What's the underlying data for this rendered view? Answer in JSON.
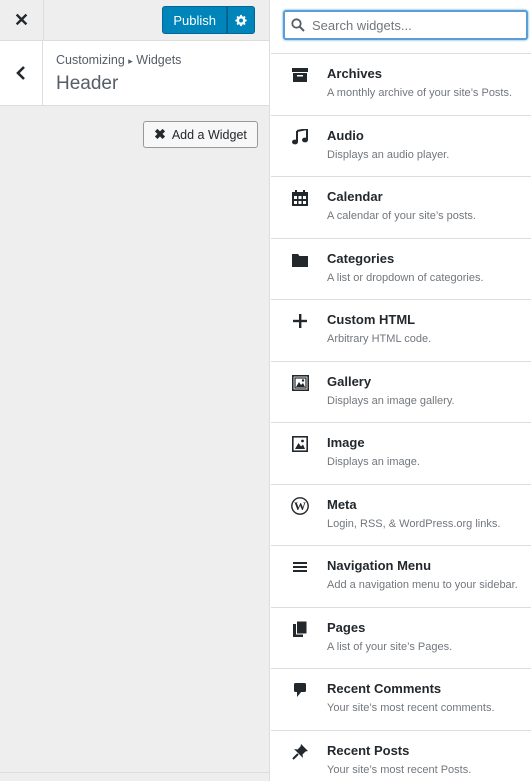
{
  "toolbar": {
    "publish_label": "Publish"
  },
  "section": {
    "breadcrumb_prefix": "Customizing",
    "breadcrumb_sep": "▸",
    "breadcrumb_panel": "Widgets",
    "title": "Header"
  },
  "add_widget_label": "Add a Widget",
  "search": {
    "placeholder": "Search widgets..."
  },
  "widgets": [
    {
      "name": "Archives",
      "desc": "A monthly archive of your site’s Posts.",
      "icon": "archive-icon"
    },
    {
      "name": "Audio",
      "desc": "Displays an audio player.",
      "icon": "music-icon"
    },
    {
      "name": "Calendar",
      "desc": "A calendar of your site’s posts.",
      "icon": "calendar-icon"
    },
    {
      "name": "Categories",
      "desc": "A list or dropdown of categories.",
      "icon": "folder-icon"
    },
    {
      "name": "Custom HTML",
      "desc": "Arbitrary HTML code.",
      "icon": "plus-icon"
    },
    {
      "name": "Gallery",
      "desc": "Displays an image gallery.",
      "icon": "gallery-icon"
    },
    {
      "name": "Image",
      "desc": "Displays an image.",
      "icon": "image-icon"
    },
    {
      "name": "Meta",
      "desc": "Login, RSS, & WordPress.org links.",
      "icon": "wordpress-icon"
    },
    {
      "name": "Navigation Menu",
      "desc": "Add a navigation menu to your sidebar.",
      "icon": "menu-icon"
    },
    {
      "name": "Pages",
      "desc": "A list of your site’s Pages.",
      "icon": "pages-icon"
    },
    {
      "name": "Recent Comments",
      "desc": "Your site’s most recent comments.",
      "icon": "comment-icon"
    },
    {
      "name": "Recent Posts",
      "desc": "Your site’s most recent Posts.",
      "icon": "pin-icon"
    }
  ],
  "colors": {
    "accent": "#0085ba",
    "panel_bg": "#eeeeee",
    "focus": "#5b9dd9"
  }
}
